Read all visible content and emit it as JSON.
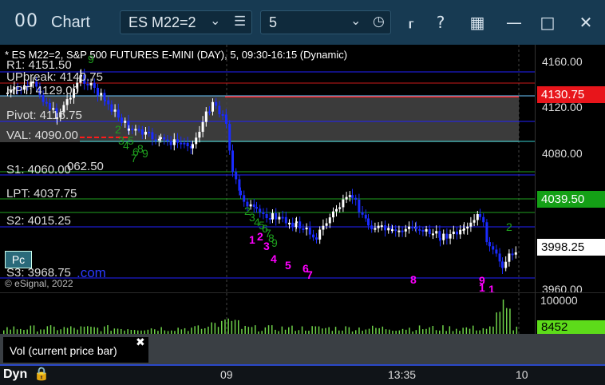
{
  "window": {
    "title": "Chart",
    "title_icon": "grid-icon"
  },
  "toolbar": {
    "symbol": "ES M22=2",
    "interval": "5",
    "help": "?"
  },
  "chart": {
    "header": "* ES M22=2, S&P 500 FUTURES E-MINI (DAY), 5, 09:30-16:15 (Dynamic)",
    "copyright": "© eSignal, 2022",
    "pc_label": "Pc",
    "com_label": ".com",
    "level_labels": {
      "r1": "R1: 4151.50",
      "upbreak": "UPbreak: 4140.75",
      "hpt": "HPT: 4129.00",
      "pivot": "Pivot: 4116.75",
      "val": "VAL: 4090.00",
      "s1": "S1: 4060.00",
      "extra": "062.50",
      "lpt": "LPT: 4037.75",
      "s2": "S2: 4015.25",
      "s3": "S3: 3968.75"
    },
    "price_ticks": [
      "4160.00",
      "4120.00",
      "4080.00",
      "3960.00"
    ],
    "price_badges": {
      "red": "4130.75",
      "green": "4039.50",
      "last": "3998.25"
    },
    "magenta_counts": [
      "1",
      "2",
      "3",
      "4",
      "5",
      "6",
      "7",
      "8",
      "9",
      "1",
      "1"
    ],
    "green_counts": [
      "9",
      "2",
      "3",
      "4",
      "5",
      "6",
      "7",
      "8",
      "9",
      "2",
      "3",
      "4",
      "5",
      "6",
      "7",
      "8",
      "9",
      "2"
    ],
    "colors": {
      "accent_red": "#ff1a1a",
      "accent_green": "#1fa01f",
      "candle_up": "#ffffff",
      "candle_down": "#1a2bff",
      "magenta": "#ff00ff"
    }
  },
  "volume": {
    "ticks": [
      "100000"
    ],
    "badge": "8452",
    "study_label": "Vol (current price bar)",
    "close": "✖"
  },
  "time_axis": {
    "dyn": "Dyn",
    "labels": [
      "09",
      "13:35",
      "10"
    ]
  }
}
